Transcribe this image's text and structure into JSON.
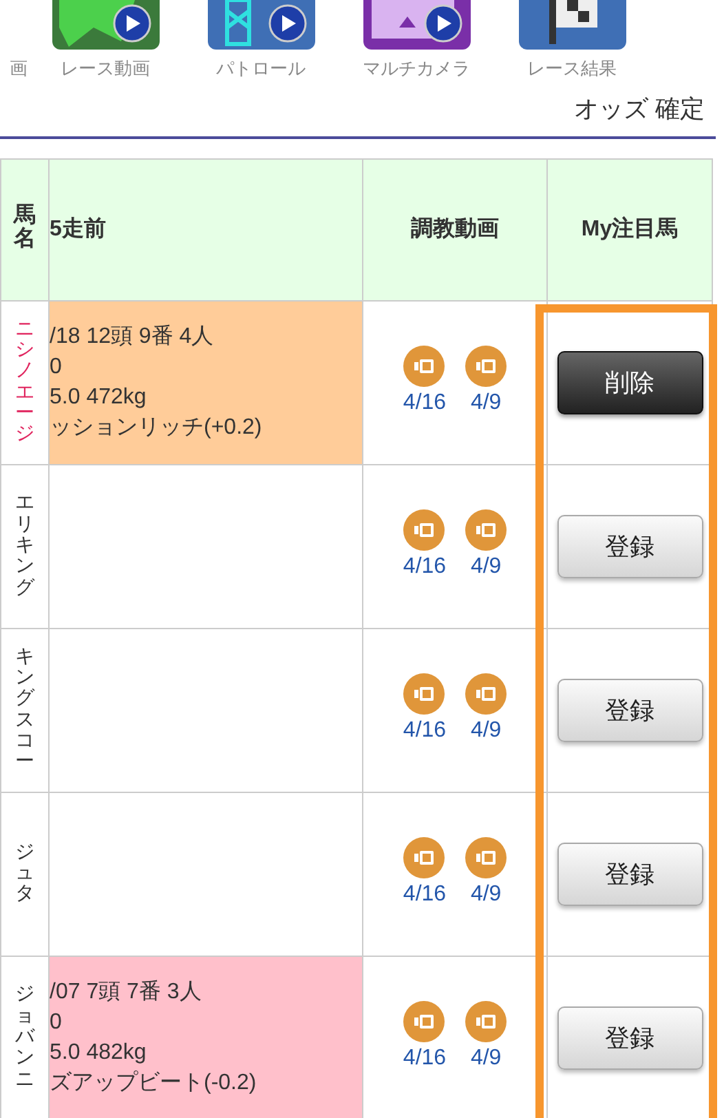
{
  "nav": [
    {
      "label": "画",
      "kind": "partial"
    },
    {
      "label": "レース動画",
      "kind": "race"
    },
    {
      "label": "パトロール",
      "kind": "patrol"
    },
    {
      "label": "マルチカメラ",
      "kind": "multi"
    },
    {
      "label": "レース結果",
      "kind": "result"
    }
  ],
  "status": "オッズ 確定",
  "table": {
    "columns": [
      "馬名",
      "5走前",
      "調教動画",
      "My注目馬"
    ],
    "rows": [
      {
        "name": "ニシノエージ",
        "highlighted": true,
        "prev": {
          "color": "#ffcc99",
          "lines": [
            "/18 12頭 9番 4人",
            "0",
            "5.0 472kg",
            "ッションリッチ(+0.2)"
          ]
        },
        "videos": [
          "4/16",
          "4/9"
        ],
        "button": {
          "label": "削除",
          "registered": true
        }
      },
      {
        "name": "エリキング",
        "highlighted": false,
        "prev": {
          "color": "#ffffff"
        },
        "videos": [
          "4/16",
          "4/9"
        ],
        "button": {
          "label": "登録",
          "registered": false
        }
      },
      {
        "name": "キングスコー",
        "highlighted": false,
        "prev": {
          "color": "#ffffff"
        },
        "videos": [
          "4/16",
          "4/9"
        ],
        "button": {
          "label": "登録",
          "registered": false
        }
      },
      {
        "name": "ジュタ",
        "highlighted": false,
        "prev": {
          "color": "#ffffff"
        },
        "videos": [
          "4/16",
          "4/9"
        ],
        "button": {
          "label": "登録",
          "registered": false
        }
      },
      {
        "name": "ジョバンニ",
        "highlighted": false,
        "prev": {
          "color": "#ffc0cb",
          "lines": [
            "/07 7頭 7番 3人",
            "0",
            "5.0 482kg",
            "ズアップビート(-0.2)"
          ]
        },
        "videos": [
          "4/16",
          "4/9"
        ],
        "button": {
          "label": "登録",
          "registered": false
        }
      }
    ]
  }
}
